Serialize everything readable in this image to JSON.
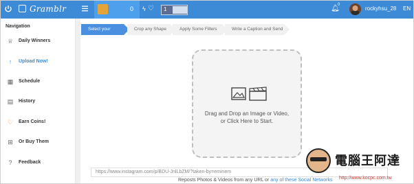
{
  "app": {
    "logo_text": "Gramblr"
  },
  "topbar": {
    "coin_count": "0",
    "toggle_number": "1",
    "bell_badge": "0",
    "username": "rockyhsu_28",
    "language": "EN"
  },
  "sidebar": {
    "title": "Navigation",
    "items": [
      {
        "label": "Daily Winners",
        "icon": "trophy-icon"
      },
      {
        "label": "Upload Now!",
        "icon": "upload-icon"
      },
      {
        "label": "Schedule",
        "icon": "calendar-icon"
      },
      {
        "label": "History",
        "icon": "history-icon"
      },
      {
        "label": "Earn Coins!",
        "icon": "heart-icon"
      },
      {
        "label": "Or Buy Them",
        "icon": "cart-icon"
      },
      {
        "label": "Feedback",
        "icon": "feedback-icon"
      }
    ]
  },
  "steps": [
    {
      "label": "Select your Media"
    },
    {
      "label": "Crop any Shape"
    },
    {
      "label": "Apply Some Filters"
    },
    {
      "label": "Write a Caption and Send"
    }
  ],
  "dropzone": {
    "line1": "Drag and Drop an Image or Video,",
    "line2": "or Click Here to Start."
  },
  "url_input": {
    "placeholder": "https://www.instagram.com/p/BDU-JnlLbZM/?taken-by=eminem"
  },
  "footer": {
    "text": "Reposts Photos & Videos from any URL or ",
    "link": "any of these Social Networks"
  },
  "watermark": {
    "title": "電腦王阿達",
    "url": "http://www.kocpc.com.tw"
  },
  "colors": {
    "topbar": "#3d8ad6",
    "accent": "#4a8fe0",
    "coin": "#e5a43a"
  }
}
